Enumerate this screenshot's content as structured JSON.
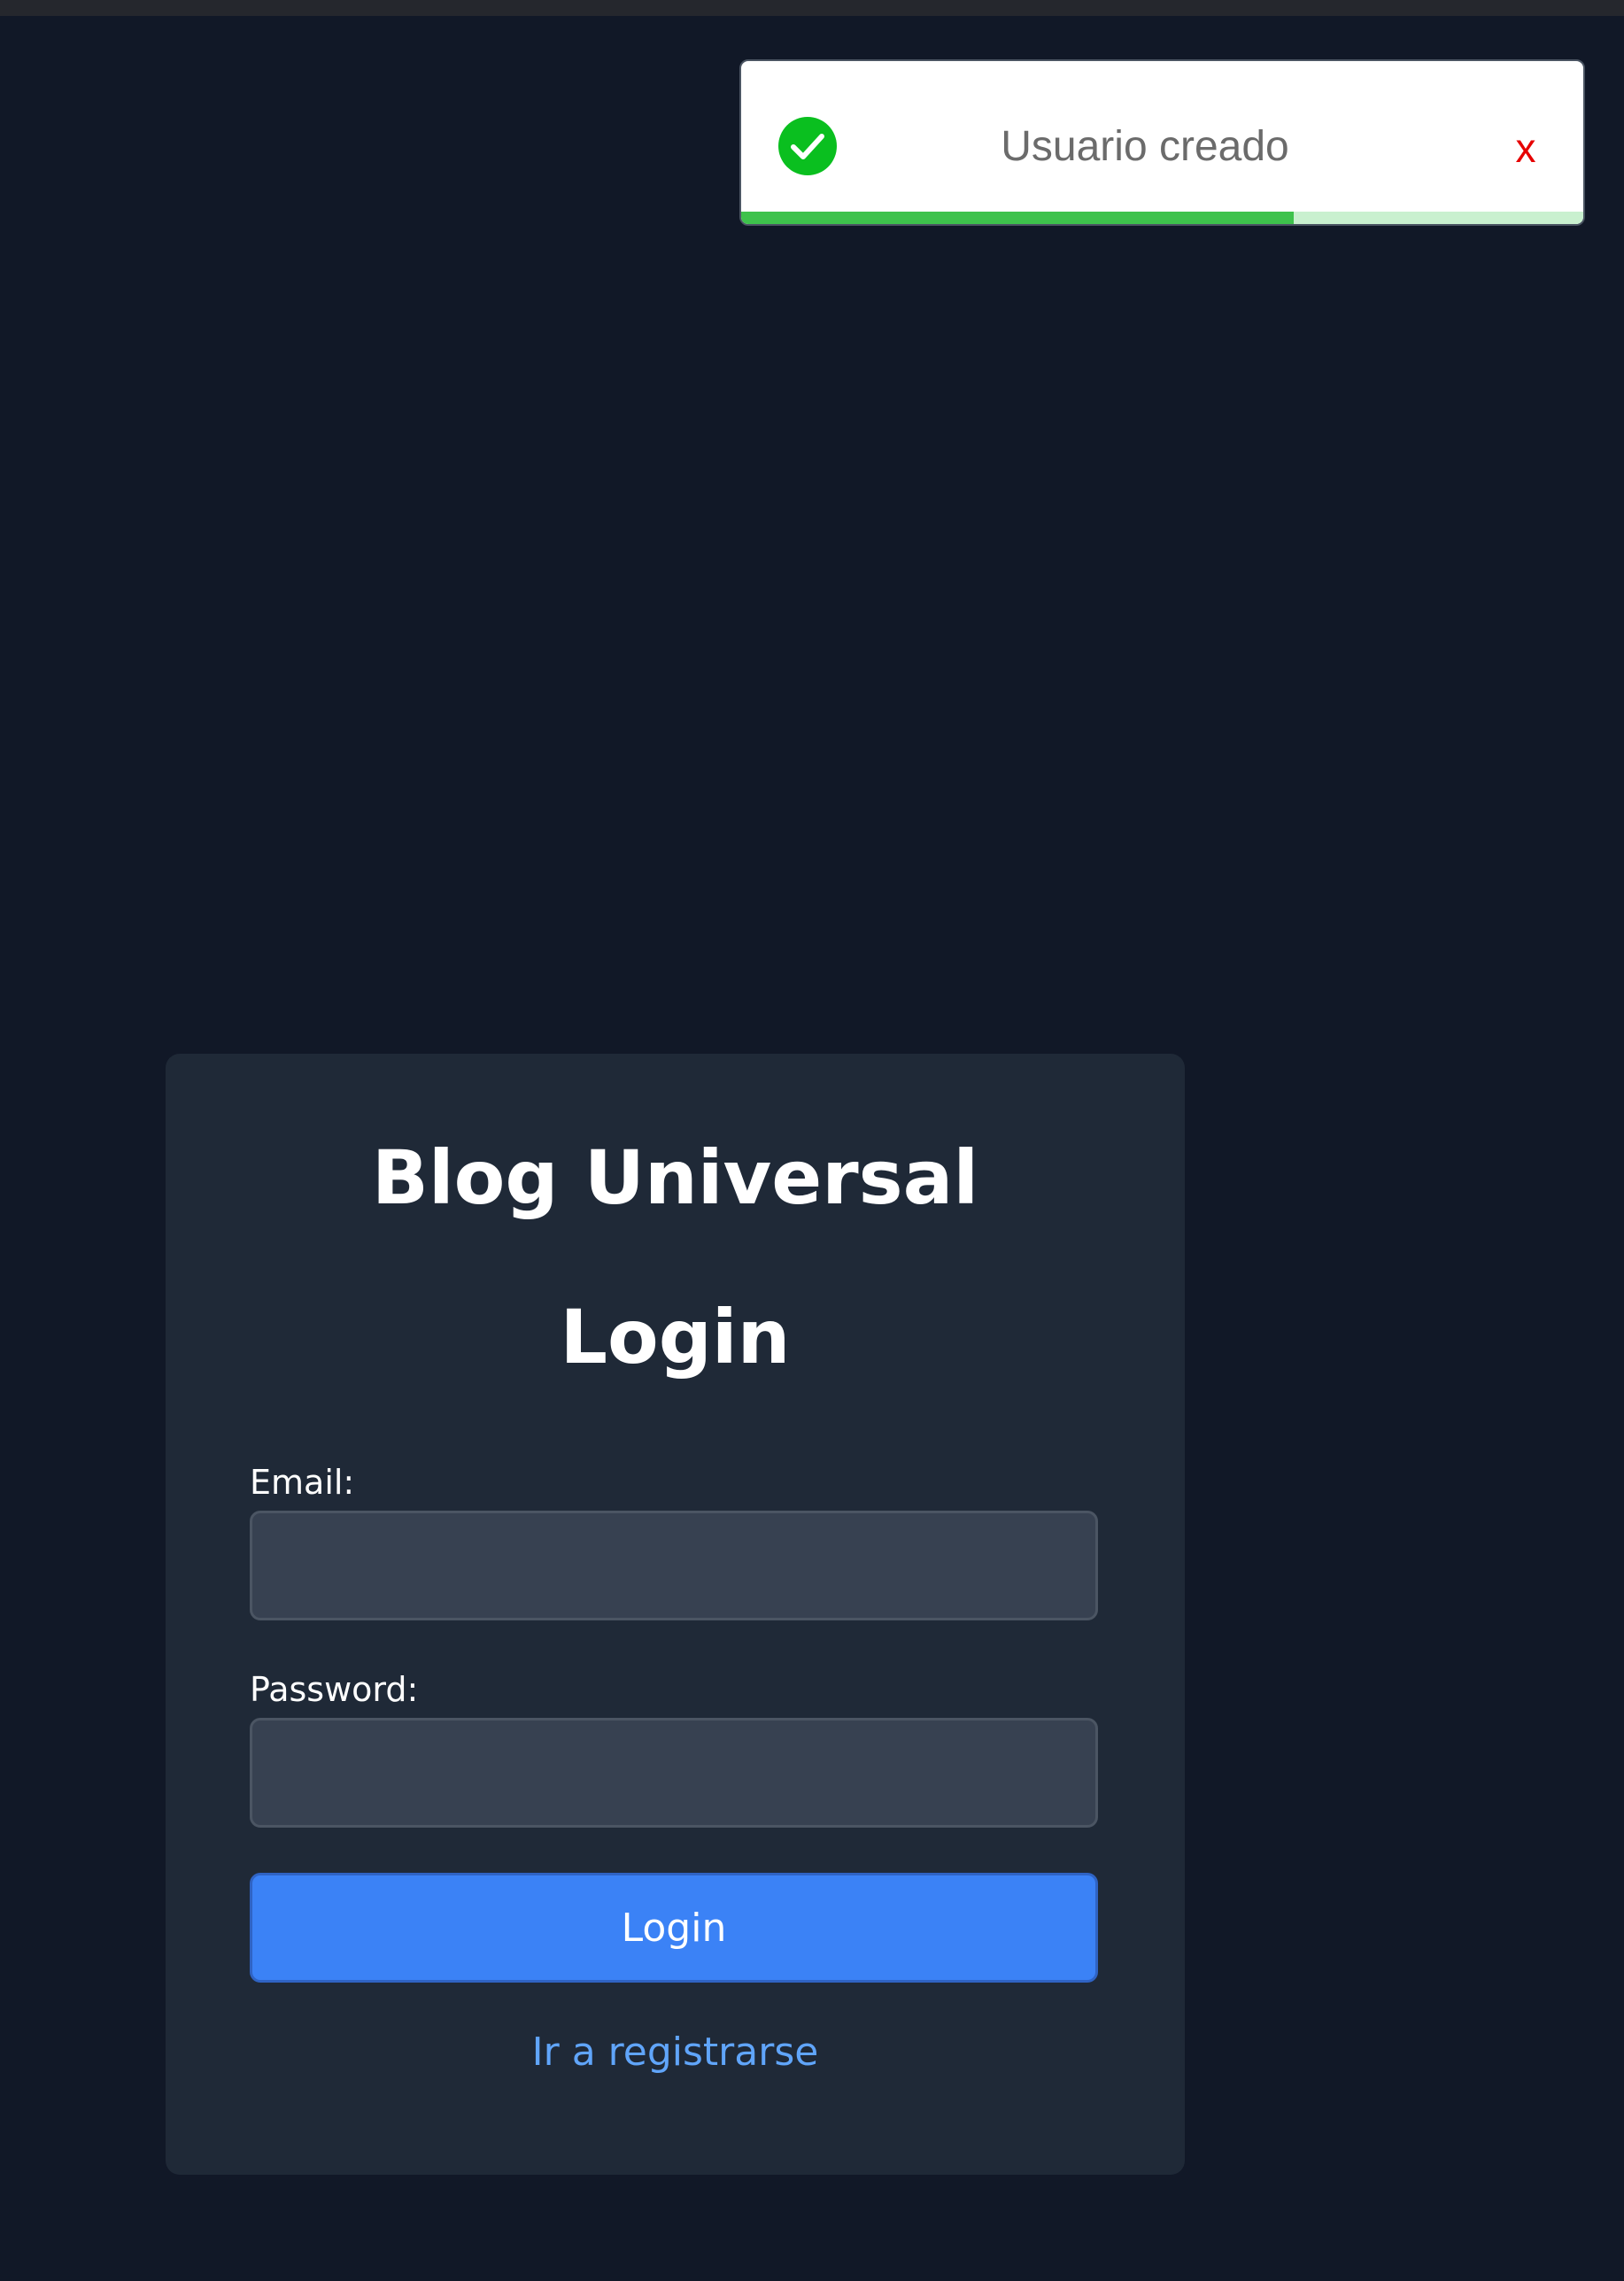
{
  "toast": {
    "message": "Usuario creado",
    "close_label": "x",
    "icon": "check-circle-icon",
    "status": "success",
    "colors": {
      "icon": "#0abf1f",
      "progress": "#3ec24c",
      "progress_track": "#c9f0cf",
      "close": "#e60000"
    },
    "progress_remaining_percent": 65.6
  },
  "login_card": {
    "site_title": "Blog Universal",
    "form_title": "Login",
    "email_label": "Email:",
    "email_value": "",
    "password_label": "Password:",
    "password_value": "",
    "submit_label": "Login",
    "register_link_label": "Ir a registrarse",
    "colors": {
      "button": "#3b82f6",
      "link": "#60a5fa"
    }
  }
}
